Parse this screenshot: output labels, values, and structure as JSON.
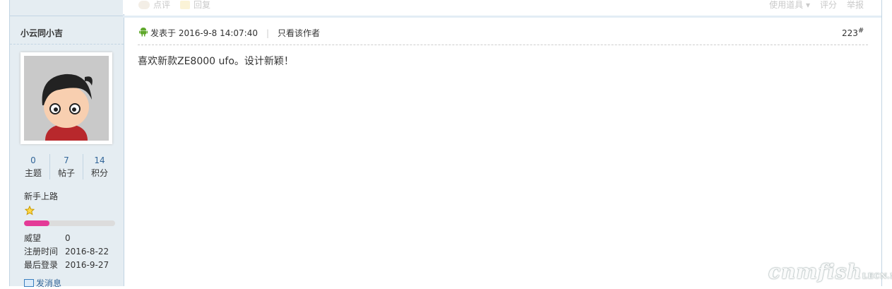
{
  "top_actions": {
    "comment": "点评",
    "reply": "回复",
    "tools": "使用道具",
    "rate": "评分",
    "report": "举报"
  },
  "user": {
    "name": "小云同小吉",
    "stats": [
      {
        "num": "0",
        "label": "主题"
      },
      {
        "num": "7",
        "label": "帖子"
      },
      {
        "num": "14",
        "label": "积分"
      }
    ],
    "level": "新手上路",
    "progress": 0.28,
    "info": [
      {
        "key": "威望",
        "val": "0"
      },
      {
        "key": "注册时间",
        "val": "2016-8-22"
      },
      {
        "key": "最后登录",
        "val": "2016-9-27"
      }
    ],
    "send_msg": "发消息"
  },
  "post": {
    "posted_label": "发表于 2016-9-8 14:07:40",
    "only_author": "只看该作者",
    "floor": "223",
    "floor_mark": "#",
    "body": "喜欢新款ZE8000 ufo。设计新颖！"
  },
  "watermark": {
    "text": "cnmfish",
    "suffix": "LECN.NET"
  }
}
